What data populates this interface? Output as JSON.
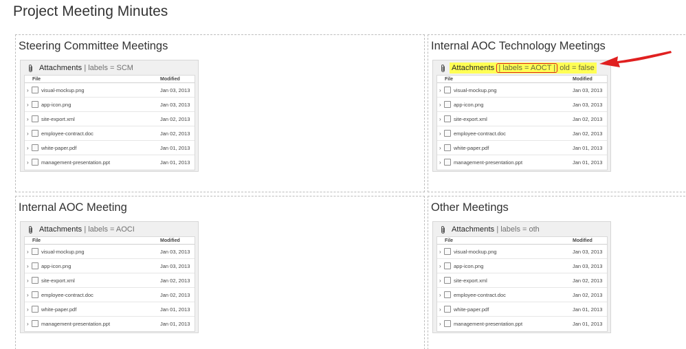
{
  "page": {
    "title": "Project Meeting Minutes"
  },
  "macro": {
    "attachments_label": "Attachments"
  },
  "table": {
    "col_file": "File",
    "col_modified": "Modified"
  },
  "files": [
    {
      "name": "visual-mockup.png",
      "modified": "Jan 03, 2013",
      "icon": "image-icon"
    },
    {
      "name": "app-icon.png",
      "modified": "Jan 03, 2013",
      "icon": "image-icon"
    },
    {
      "name": "site-export.xml",
      "modified": "Jan 02, 2013",
      "icon": "xml-file-icon"
    },
    {
      "name": "employee-contract.doc",
      "modified": "Jan 02, 2013",
      "icon": "word-doc-icon"
    },
    {
      "name": "white-paper.pdf",
      "modified": "Jan 01, 2013",
      "icon": "pdf-file-icon"
    },
    {
      "name": "management-presentation.ppt",
      "modified": "Jan 01, 2013",
      "icon": "presentation-file-icon"
    }
  ],
  "sections": [
    {
      "title": "Steering Committee Meetings",
      "labels_text": "| labels = SCM"
    },
    {
      "title": "Internal AOC Technology Meetings",
      "labels_text": "| labels = AOCT |",
      "old_text": "old = false"
    },
    {
      "title": "Internal AOC Meeting",
      "labels_text": "| labels = AOCI"
    },
    {
      "title": "Other Meetings",
      "labels_text": "| labels = oth"
    }
  ],
  "colors": {
    "highlight": "#ffff55",
    "annotation_red": "#e02020"
  }
}
